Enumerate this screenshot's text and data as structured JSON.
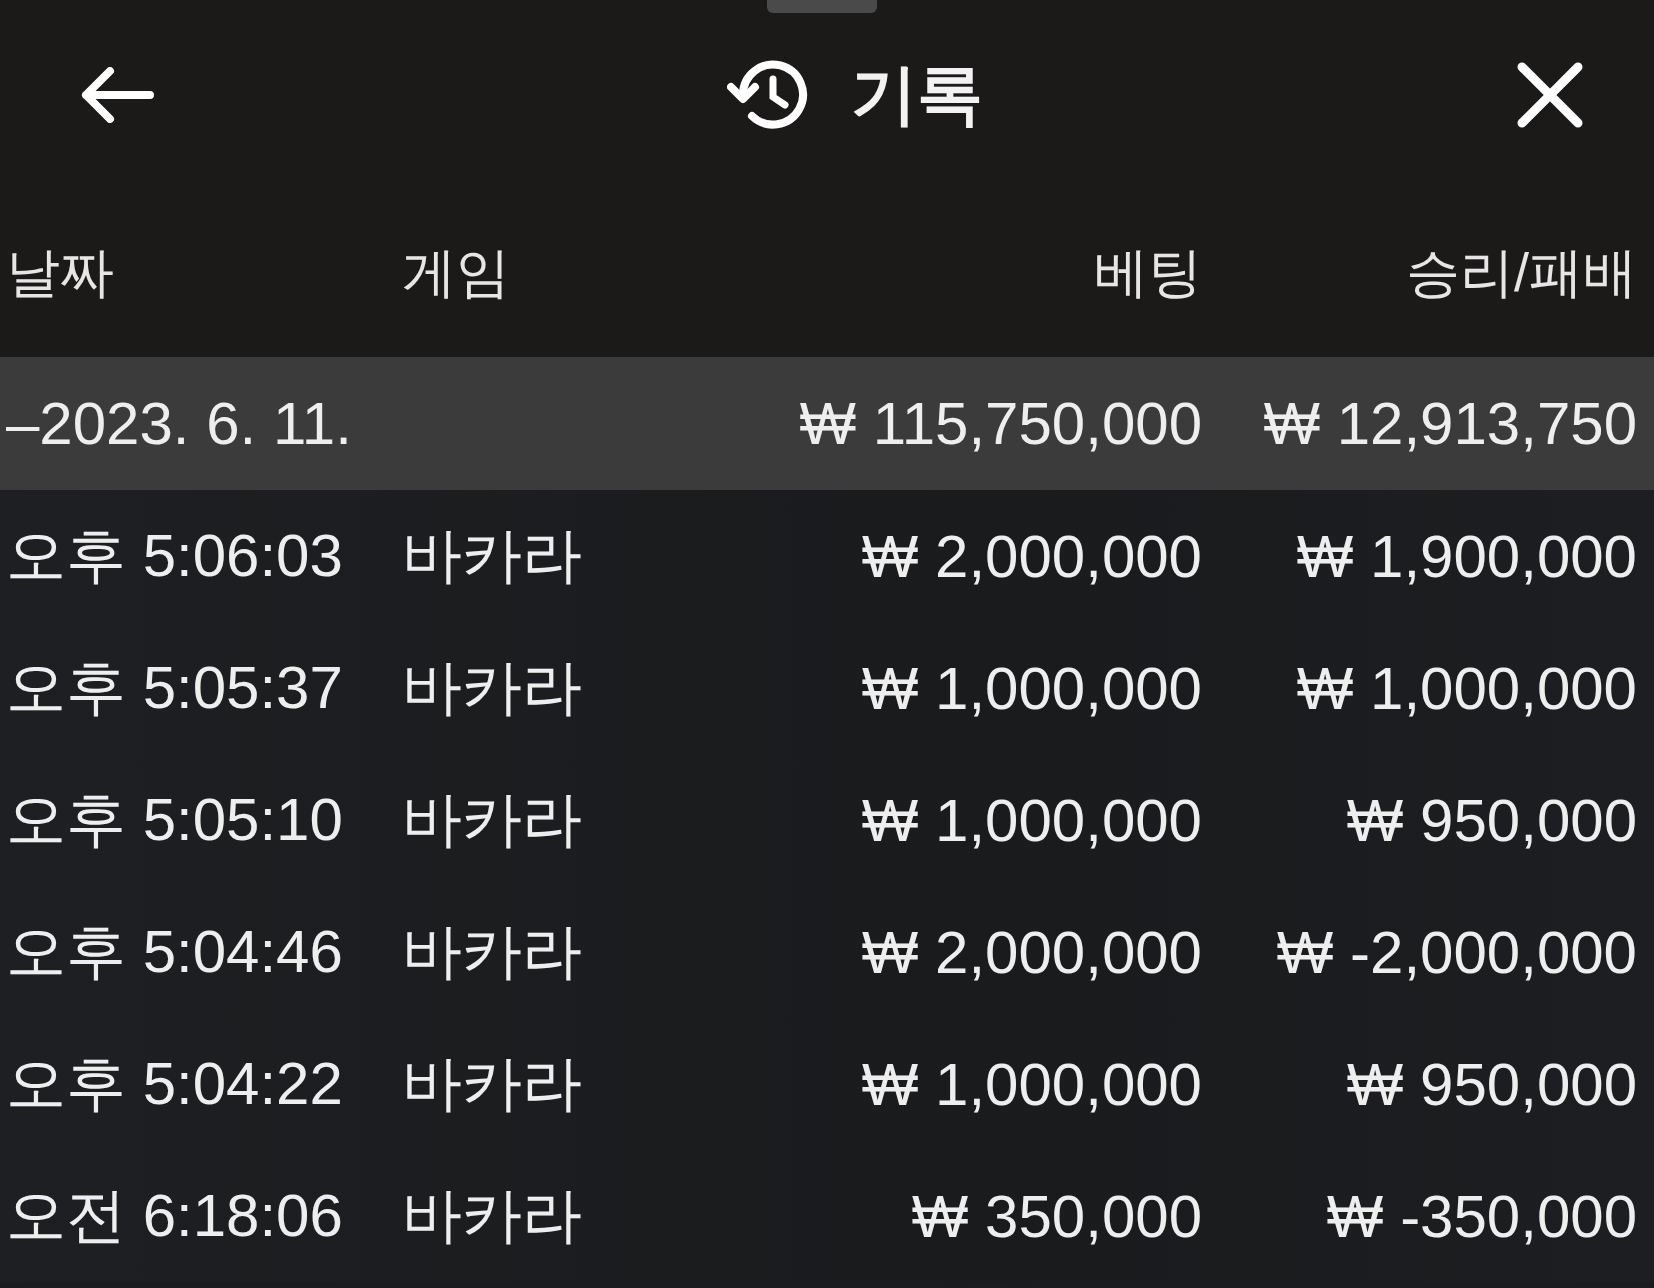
{
  "header": {
    "title": "기록"
  },
  "columns": [
    "날짜",
    "게임",
    "베팅",
    "승리/패배"
  ],
  "group": {
    "date": "–2023. 6. 11.",
    "bet": "₩ 115,750,000",
    "result": "₩ 12,913,750"
  },
  "rows": [
    {
      "time": "오후 5:06:03",
      "game": "바카라",
      "bet": "₩ 2,000,000",
      "result": "₩ 1,900,000"
    },
    {
      "time": "오후 5:05:37",
      "game": "바카라",
      "bet": "₩ 1,000,000",
      "result": "₩ 1,000,000"
    },
    {
      "time": "오후 5:05:10",
      "game": "바카라",
      "bet": "₩ 1,000,000",
      "result": "₩ 950,000"
    },
    {
      "time": "오후 5:04:46",
      "game": "바카라",
      "bet": "₩ 2,000,000",
      "result": "₩ -2,000,000"
    },
    {
      "time": "오후 5:04:22",
      "game": "바카라",
      "bet": "₩ 1,000,000",
      "result": "₩ 950,000"
    },
    {
      "time": "오전 6:18:06",
      "game": "바카라",
      "bet": "₩ 350,000",
      "result": "₩ -350,000"
    }
  ]
}
